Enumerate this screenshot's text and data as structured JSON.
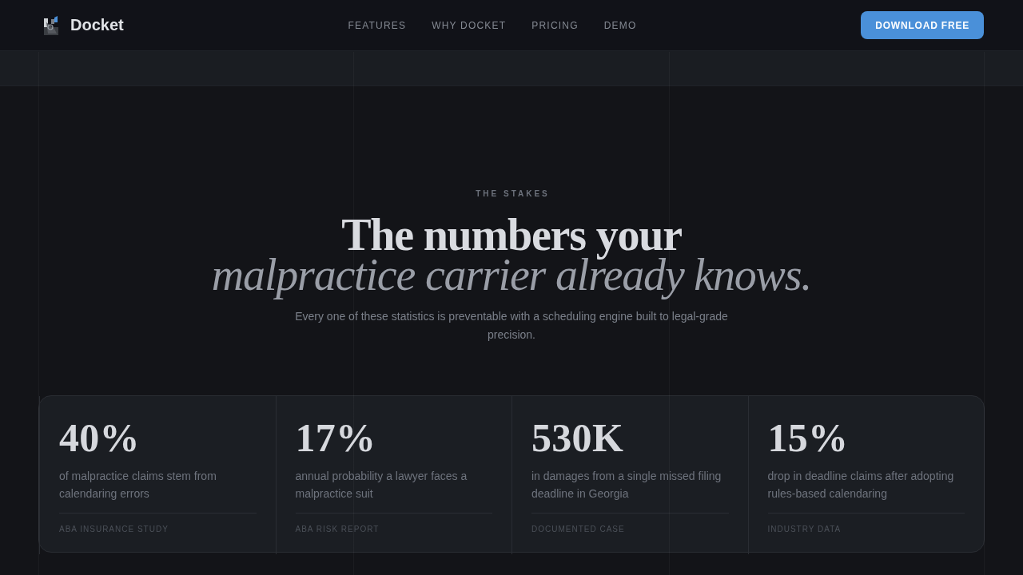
{
  "header": {
    "brand": "Docket",
    "links": [
      {
        "label": "FEATURES"
      },
      {
        "label": "WHY DOCKET"
      },
      {
        "label": "PRICING"
      },
      {
        "label": "DEMO"
      }
    ],
    "cta": "DOWNLOAD FREE"
  },
  "hero": {
    "eyebrow": "THE STAKES",
    "title": "The numbers your *malpractice carrier already knows.*",
    "subtitle": "Every one of these statistics is preventable with a scheduling engine built to legal-grade precision."
  },
  "stats": [
    {
      "value": "40%",
      "description": "of malpractice claims stem from calendaring errors",
      "source": "ABA INSURANCE STUDY"
    },
    {
      "value": "17%",
      "description": "annual probability a lawyer faces a malpractice suit",
      "source": "ABA RISK REPORT"
    },
    {
      "value": "530K",
      "description": "in damages from a single missed filing deadline in Georgia",
      "source": "DOCUMENTED CASE"
    },
    {
      "value": "15%",
      "description": "drop in deadline claims after adopting rules-based calendaring",
      "source": "INDUSTRY DATA"
    }
  ]
}
